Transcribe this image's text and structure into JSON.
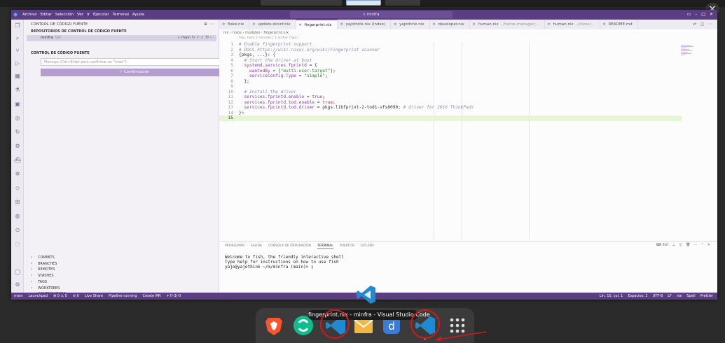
{
  "titlebar": {
    "menu": [
      "Archivo",
      "Editar",
      "Selección",
      "Ver",
      "Ir",
      "Ejecutar",
      "Terminal",
      "Ayuda"
    ],
    "command_center": "minfra"
  },
  "sidebar": {
    "title": "CONTROL DE CÓDIGO FUENTE",
    "repos_header": "REPOSITORIOS DE CONTROL DE CÓDIGO FUENTE",
    "repo_name": "minfra",
    "repo_vcs": "Git",
    "repo_branch": "main",
    "scm_header": "CONTROL DE CÓDIGO FUENTE",
    "commit_placeholder": "Mensaje (Ctrl+Enter para confirmar en \"main\")",
    "commit_button": "✓ Confirmación",
    "sections": [
      "COMMITS",
      "BRANCHES",
      "REMOTES",
      "STASHES",
      "TAGS",
      "WORKTREES",
      "CONTRIBUTORS",
      "GIT WORKTREES"
    ]
  },
  "tabs": [
    {
      "label": "flake.nix",
      "path": ""
    },
    {
      "label": "update-dconf.nix",
      "path": ""
    },
    {
      "label": "fingerprint.nix",
      "path": ""
    },
    {
      "label": "yajothink.nix (Index)",
      "path": ""
    },
    {
      "label": "yajothink.nix",
      "path": ""
    },
    {
      "label": "developer.nix",
      "path": ""
    },
    {
      "label": "human.nix",
      "path": "../home-manager/..."
    },
    {
      "label": "human.nix",
      "path": "../nixos/..."
    },
    {
      "label": "README.md",
      "path": ""
    }
  ],
  "active_tab_index": 2,
  "breadcrumb": "nix › nixos › modules › fingerprint.nix",
  "blame": "Yaju, hace 2 minutos | 1 author (Yaju)",
  "code_lines": [
    {
      "n": "1",
      "parts": [
        [
          "c-comment",
          "# Enable fingerprint support"
        ]
      ]
    },
    {
      "n": "2",
      "parts": [
        [
          "c-comment",
          "# DOCS https://wiki.nixos.org/wiki/Fingerprint_scanner"
        ]
      ]
    },
    {
      "n": "3",
      "parts": [
        [
          "c-plain",
          "{pkgs, ...}: {"
        ]
      ]
    },
    {
      "n": "4",
      "parts": [
        [
          "c-comment",
          "  # Start the driver at boot"
        ]
      ]
    },
    {
      "n": "5",
      "parts": [
        [
          "c-key",
          "  systemd.services.fprintd"
        ],
        [
          "c-plain",
          " = {"
        ]
      ]
    },
    {
      "n": "6",
      "parts": [
        [
          "c-key",
          "    wantedBy"
        ],
        [
          "c-plain",
          " = ["
        ],
        [
          "c-str",
          "\"multi-user.target\""
        ],
        [
          "c-plain",
          "];"
        ]
      ]
    },
    {
      "n": "7",
      "parts": [
        [
          "c-key",
          "    serviceConfig.Type"
        ],
        [
          "c-plain",
          " = "
        ],
        [
          "c-str",
          "\"simple\""
        ],
        [
          "c-plain",
          ";"
        ]
      ]
    },
    {
      "n": "8",
      "parts": [
        [
          "c-plain",
          "  };"
        ]
      ]
    },
    {
      "n": "9",
      "parts": [
        [
          "c-plain",
          ""
        ]
      ]
    },
    {
      "n": "10",
      "parts": [
        [
          "c-comment",
          "  # Install the driver"
        ]
      ]
    },
    {
      "n": "11",
      "parts": [
        [
          "c-key",
          "  services.fprintd.enable"
        ],
        [
          "c-plain",
          " = "
        ],
        [
          "c-kw",
          "true"
        ],
        [
          "c-plain",
          ";"
        ]
      ]
    },
    {
      "n": "12",
      "parts": [
        [
          "c-key",
          "  services.fprintd.tod.enable"
        ],
        [
          "c-plain",
          " = "
        ],
        [
          "c-kw",
          "true"
        ],
        [
          "c-plain",
          ";"
        ]
      ]
    },
    {
      "n": "13",
      "parts": [
        [
          "c-key",
          "  services.fprintd.tod.driver"
        ],
        [
          "c-plain",
          " = pkgs.libfprint-2-tod1-vfs0090; "
        ],
        [
          "c-comment",
          "# driver for 2016 ThinkPads"
        ]
      ]
    },
    {
      "n": "14",
      "parts": [
        [
          "c-plain",
          "}"
        ],
        [
          "c-str",
          "✎"
        ]
      ]
    },
    {
      "n": "15",
      "parts": [
        [
          "c-plain",
          ""
        ]
      ]
    }
  ],
  "current_line": "15",
  "panel": {
    "tabs": [
      "PROBLEMAS",
      "SALIDA",
      "CONSOLA DE DEPURACIÓN",
      "TERMINAL",
      "PUERTOS",
      "GITLENS"
    ],
    "active": "TERMINAL",
    "shell_label": "fish",
    "terminal_lines": [
      "Welcome to fish, the friendly interactive shell",
      "Type help for instructions on how to use fish",
      "yajo@yajothink ~/m/minfra (main)> ▯"
    ]
  },
  "statusbar": {
    "left": [
      "main",
      "Launchpad",
      "⊗ 0 ⚠ 0",
      "⊘ 0",
      "Live Share",
      "Pipeline running",
      "Create MR",
      "+7/-3/-0"
    ],
    "right": [
      "Lín. 15, col. 1",
      "Espacios: 2",
      "UTF-8",
      "LF",
      "nix",
      "Spell",
      "Prettier"
    ]
  },
  "dock": {
    "tooltip": "fingerprint.nix - minfra - Visual Studio Code",
    "apps": [
      "brave-icon",
      "element-icon",
      "vscode-icon",
      "mail-icon",
      "dash-icon",
      "vscode-icon",
      "app-grid-icon"
    ]
  },
  "colors": {
    "accent": "#5b3d84",
    "annotation_red": "#d4191b",
    "vscode_blue": "#1f8ad2"
  }
}
